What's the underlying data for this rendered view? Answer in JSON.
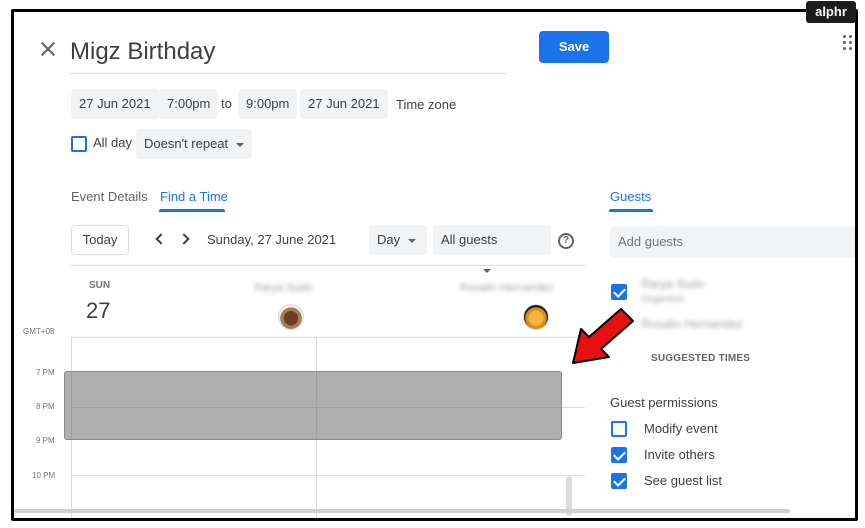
{
  "brand": {
    "logo_text": "alphr"
  },
  "event": {
    "title": "Migz Birthday",
    "start_date": "27 Jun 2021",
    "start_time": "7:00pm",
    "to_label": "to",
    "end_time": "9:00pm",
    "end_date": "27 Jun 2021",
    "timezone_label": "Time zone",
    "all_day_label": "All day",
    "all_day_checked": false,
    "repeat_label": "Doesn't repeat"
  },
  "toolbar": {
    "save_label": "Save"
  },
  "tabs": [
    {
      "label": "Event Details",
      "active": false
    },
    {
      "label": "Find a Time",
      "active": true
    }
  ],
  "find_time": {
    "today_label": "Today",
    "date_label": "Sunday, 27 June 2021",
    "view_select": "Day",
    "guests_select": "All guests",
    "day_name": "SUN",
    "day_number": "27",
    "timezone": "GMT+08",
    "hours": [
      "7 PM",
      "8 PM",
      "9 PM",
      "10 PM"
    ],
    "columns": [
      {
        "name": "Rarya Sudo",
        "avatar": "dog-avatar"
      },
      {
        "name": "Rosalin Hernandez",
        "avatar": "cat-avatar"
      }
    ]
  },
  "guests_panel": {
    "tab_label": "Guests",
    "add_guests_placeholder": "Add guests",
    "guests": [
      {
        "name": "Rarya Sudo",
        "role": "Organiser"
      },
      {
        "name": "Rosalin Hernandez",
        "role": ""
      }
    ],
    "suggested_times_label": "SUGGESTED TIMES",
    "permissions_title": "Guest permissions",
    "permissions": [
      {
        "label": "Modify event",
        "checked": false
      },
      {
        "label": "Invite others",
        "checked": true
      },
      {
        "label": "See guest list",
        "checked": true
      }
    ]
  },
  "colors": {
    "accent": "#1a73e8",
    "arrow": "#e81010",
    "busy_block": "#8c8c8c"
  }
}
